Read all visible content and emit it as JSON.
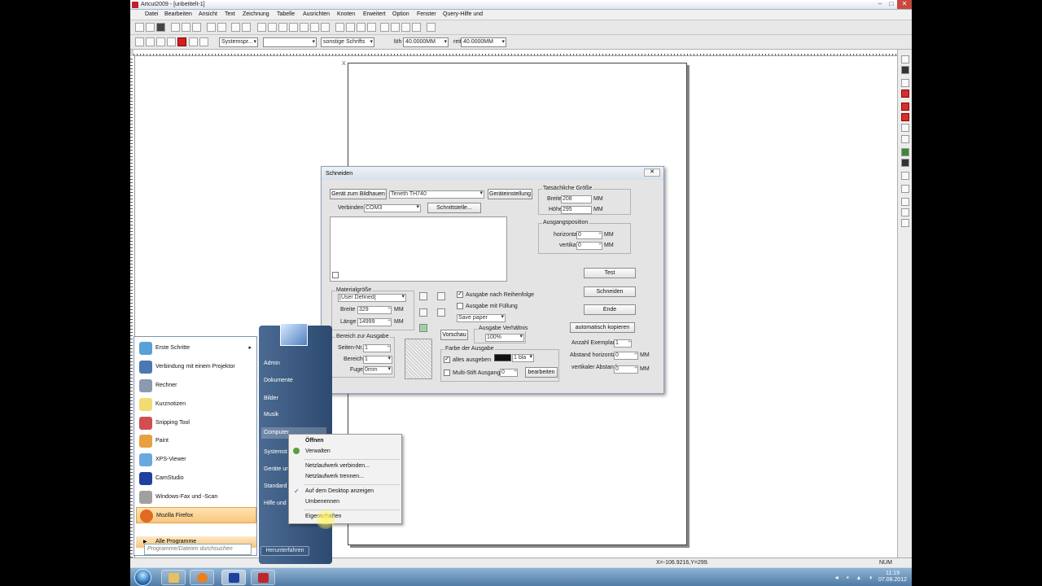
{
  "window": {
    "title": "Artcut2009 - [unbetitelt-1]",
    "menu": [
      "Datei",
      "Bearbeiten",
      "Ansicht",
      "Text",
      "Zeichnung",
      "Tabelle",
      "Ausrichten",
      "Knoten",
      "Erweitert",
      "Option",
      "Fenster",
      "Query-Hilfe und"
    ]
  },
  "toolbar": {
    "font_combo": "Systemspr...",
    "size_combo": "",
    "font_style_combo": "sonstige Schrifts",
    "width_label": "löh",
    "width_value": "40.0000MM",
    "height_label": "reit",
    "height_value": "40.0000MM"
  },
  "canvas": {
    "origin_mark": "X"
  },
  "statusbar": {
    "coords": "X=-106.9216,Y=299.",
    "num": "NUM"
  },
  "dialog": {
    "title": "Schneiden",
    "close": "✕",
    "device_button": "Gerät zum Bildhauen",
    "device_value": "Teneth TH740",
    "device_settings": "Geräteinstellung",
    "connect_label": "Verbinden",
    "connect_value": "COM3",
    "interface_button": "Schnittstelle...",
    "actual_size": {
      "title": "Tatsächliche Größe",
      "width_label": "Breite",
      "width_value": "208",
      "height_label": "Höhe",
      "height_value": "295",
      "unit": "MM"
    },
    "output_pos": {
      "title": "Ausgangsposition",
      "h_label": "horizontal",
      "h_value": "0",
      "v_label": "vertikal",
      "v_value": "0",
      "unit": "MM"
    },
    "test_button": "Test",
    "cut_button": "Schneiden",
    "end_button": "Ende",
    "material": {
      "title": "Materialgröße",
      "preset": "[User Defined]",
      "width_label": "Breite",
      "width_value": "329",
      "length_label": "Länge",
      "length_value": "14999",
      "unit": "MM"
    },
    "order_check": "Ausgabe nach Reihenfolge",
    "fill_check": "Ausgabe mit Füllung",
    "save_paper": "Save paper",
    "range": {
      "title": "Bereich zur Ausgabe",
      "page_label": "Seiten-Nr.",
      "page_value": "1",
      "area_label": "Bereich",
      "area_value": "1",
      "gap_label": "Fuge",
      "gap_value": "0mm"
    },
    "preview_button": "Vorschau",
    "ratio": {
      "title": "Ausgabe Verhältnis",
      "value": "100%"
    },
    "color": {
      "title": "Farbe der Ausgabe",
      "all_label": "alles ausgeben",
      "color_value": "1 bla",
      "multi_label": "Multi-Stift Ausgang",
      "multi_value": "0",
      "edit_button": "bearbeiten"
    },
    "auto_copy": "automatisch kopieren",
    "copies_label": "Anzahl Exemplare",
    "copies_value": "1",
    "hgap_label": "Abstand horizontal",
    "hgap_value": "0",
    "vgap_label": "vertikaler Abstand",
    "vgap_value": "0",
    "mm": "MM"
  },
  "startmenu": {
    "items": [
      {
        "label": "Erste Schritte",
        "arrow": "▸"
      },
      {
        "label": "Verbindung mit einem Projektor"
      },
      {
        "label": "Rechner"
      },
      {
        "label": "Kurznotizen"
      },
      {
        "label": "Snipping Tool"
      },
      {
        "label": "Paint"
      },
      {
        "label": "XPS-Viewer"
      },
      {
        "label": "CamStudio"
      },
      {
        "label": "Windows-Fax und -Scan"
      },
      {
        "label": "Mozilla Firefox"
      }
    ],
    "all_programs": "Alle Programme",
    "search_placeholder": "Programme/Dateien durchsuchen",
    "right": [
      "Admin",
      "Dokumente",
      "Bilder",
      "Musik",
      "Computer",
      "Systemst",
      "Geräte un",
      "Standard",
      "Hilfe und"
    ],
    "shutdown": "Herunterfahren"
  },
  "context_menu": {
    "open": "Öffnen",
    "manage": "Verwalten",
    "map_drive": "Netzlaufwerk verbinden...",
    "disconnect_drive": "Netzlaufwerk trennen...",
    "show_desktop": "Auf dem Desktop anzeigen",
    "rename": "Umbenennen",
    "properties": "Eigenschaften",
    "check": "✓"
  },
  "taskbar": {
    "time": "11:19",
    "date": "07.08.2012"
  },
  "colors": {
    "accent": "#4f7aa5",
    "highlight": "#f9c67d",
    "close": "#c9483c"
  }
}
